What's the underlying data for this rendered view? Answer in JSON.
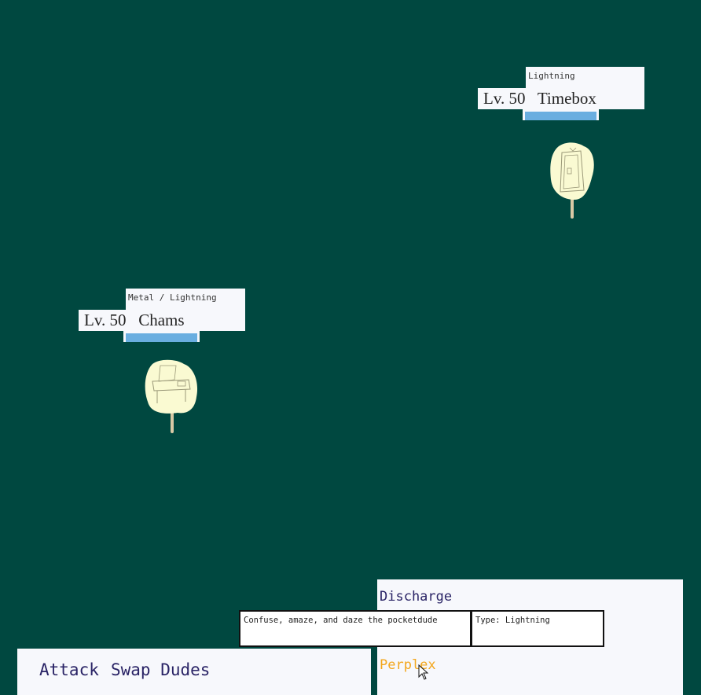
{
  "opponent": {
    "type": "Lightning",
    "level_name": "Lv. 50   Timebox",
    "hp_fraction": 1.0,
    "sprite_icon": "phone-booth-sketch-icon"
  },
  "player": {
    "type": "Metal / Lightning",
    "level_name": "Lv. 50   Chams",
    "hp_fraction": 1.0,
    "sprite_icon": "desk-sketch-icon"
  },
  "command_menu": {
    "attack_label": "Attack",
    "swap_label": "Swap Dudes"
  },
  "moves": {
    "items": [
      "Discharge",
      "",
      "Perplex"
    ],
    "selected": "Perplex"
  },
  "tooltip": {
    "description": "Confuse, amaze, and daze the pocketdude",
    "type_text": "Type: Lightning"
  },
  "colors": {
    "background": "#004840",
    "panel": "#f7f8fc",
    "hp_bar": "#6aaee0",
    "text": "#2a2466",
    "selected": "#f3a61c"
  }
}
